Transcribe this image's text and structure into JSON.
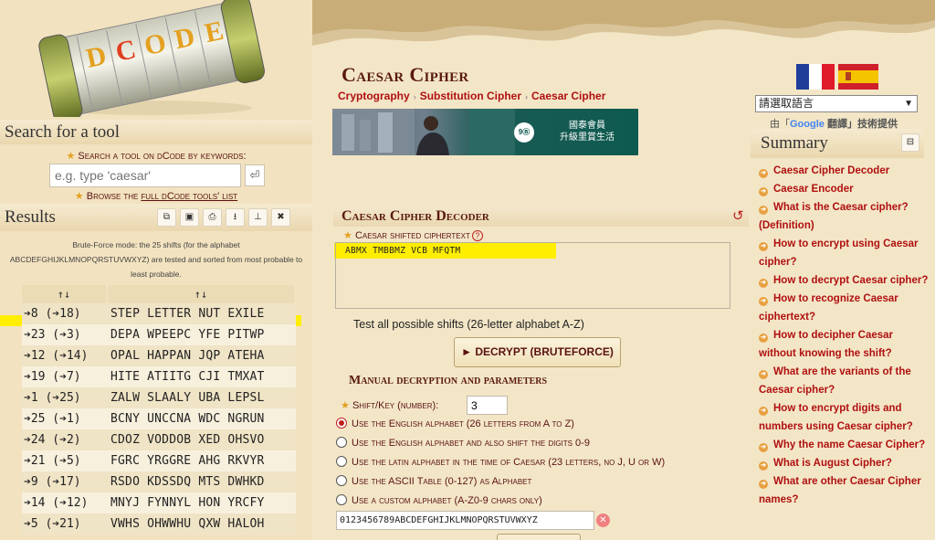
{
  "logo": {
    "letters": [
      "D",
      "C",
      "O",
      "D",
      "E"
    ]
  },
  "search": {
    "heading": "Search for a tool",
    "line1": "Search a tool on dCode by keywords:",
    "placeholder": "e.g. type 'caesar'",
    "browse_prefix": "Browse the",
    "browse_link": "full dCode tools' list"
  },
  "results": {
    "heading": "Results",
    "note": "Brute-Force mode: the 25 shifts (for the alphabet ABCDEFGHIJKLMNOPQRSTUVWXYZ) are tested and sorted from most probable to least probable.",
    "col1": "↑↓",
    "col2": "↑↓",
    "rows": [
      {
        "shift": "➔8 (➔18)",
        "text": "STEP LETTER NUT EXILE"
      },
      {
        "shift": "➔23 (➔3)",
        "text": "DEPA WPEEPC YFE PITWP"
      },
      {
        "shift": "➔12 (➔14)",
        "text": "OPAL HAPPAN JQP ATEHA"
      },
      {
        "shift": "➔19 (➔7)",
        "text": "HITE ATIITG CJI TMXAT"
      },
      {
        "shift": "➔1 (➔25)",
        "text": "ZALW SLAALY UBA LEPSL"
      },
      {
        "shift": "➔25 (➔1)",
        "text": "BCNY UNCCNA WDC NGRUN"
      },
      {
        "shift": "➔24 (➔2)",
        "text": "CDOZ VODDOB XED OHSVO"
      },
      {
        "shift": "➔21 (➔5)",
        "text": "FGRC YRGGRE AHG RKVYR"
      },
      {
        "shift": "➔9 (➔17)",
        "text": "RSDO KDSSDQ MTS DWHKD"
      },
      {
        "shift": "➔14 (➔12)",
        "text": "MNYJ FYNNYL HON YRCFY"
      },
      {
        "shift": "➔5 (➔21)",
        "text": "VWHS OHWWHU QXW HALOH"
      }
    ]
  },
  "page": {
    "title": "Caesar Cipher",
    "breadcrumb": [
      "Cryptography",
      "Substitution Cipher",
      "Caesar Cipher"
    ]
  },
  "ad": {
    "line1": "國泰會員",
    "line2": "升級里賞生活"
  },
  "decoder": {
    "title": "Caesar Cipher Decoder",
    "ciphertext_label": "Caesar shifted ciphertext",
    "ciphertext": "ABMX TMBBMZ VCB MFQTM",
    "test_all": "Test all possible shifts (26-letter alphabet A-Z)",
    "decrypt_button": "► DECRYPT (BRUTEFORCE)",
    "manual_title": "Manual decryption and parameters",
    "shift_label": "Shift/Key (number):",
    "shift_value": "3",
    "options": [
      "Use the English alphabet (26 letters from A to Z)",
      "Use the English alphabet and also shift the digits 0-9",
      "Use the latin alphabet in the time of Caesar (23 letters, no J, U or W)",
      "Use the ASCII Table (0-127) as Alphabet",
      "Use a custom alphabet (A-Z0-9 chars only)"
    ],
    "selected_option": 0,
    "custom_alphabet": "0123456789ABCDEFGHIJKLMNOPQRSTUVWXYZ"
  },
  "lang": {
    "select_label": "請選取語言",
    "powered_prefix": "由「",
    "powered_google": "Google",
    "powered_translate": "翻譯」技術提供"
  },
  "summary": {
    "heading": "Summary",
    "items": [
      "Caesar Cipher Decoder",
      "Caesar Encoder",
      "What is the Caesar cipher? (Definition)",
      "How to encrypt using Caesar cipher?",
      "How to decrypt Caesar cipher?",
      "How to recognize Caesar ciphertext?",
      "How to decipher Caesar without knowing the shift?",
      "What are the variants of the Caesar cipher?",
      "How to encrypt digits and numbers using Caesar cipher?",
      "Why the name Caesar Cipher?",
      "What is August Cipher?",
      "What are other Caesar Cipher names?"
    ]
  },
  "colors": {
    "accent": "#b01010",
    "highlight": "#ffee00",
    "title": "#5a1a0e",
    "background": "#f3e6c7"
  }
}
